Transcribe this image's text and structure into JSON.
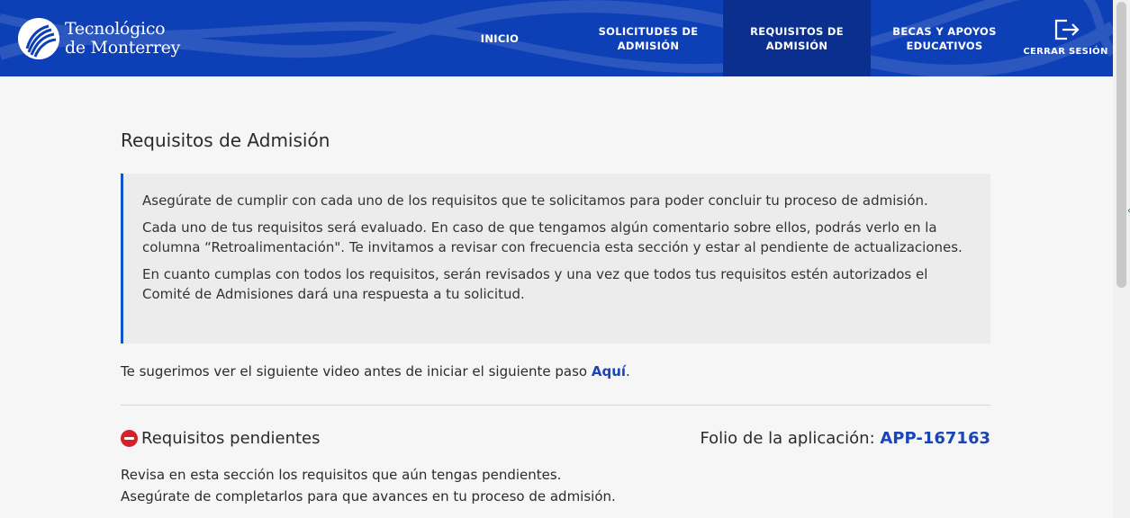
{
  "header": {
    "logo_line1": "Tecnológico",
    "logo_line2": "de Monterrey",
    "nav": {
      "inicio": "INICIO",
      "solicitudes_line1": "SOLICITUDES DE",
      "solicitudes_line2": "ADMISIÓN",
      "requisitos_line1": "REQUISITOS DE",
      "requisitos_line2": "ADMISIÓN",
      "becas_line1": "BECAS Y APOYOS",
      "becas_line2": "EDUCATIVOS",
      "logout": "CERRAR SESIÓN"
    },
    "active_tab": "requisitos",
    "colors": {
      "header_bg": "#0d3fb6",
      "active_tab_bg": "#0b2f8f"
    }
  },
  "main": {
    "title": "Requisitos de Admisión",
    "info": {
      "p1": "Asegúrate de cumplir con cada uno de los requisitos que te solicitamos para poder concluir tu proceso de admisión.",
      "p2": "Cada uno de tus requisitos será evaluado. En caso de que tengamos algún comentario sobre ellos, podrás verlo en la columna “Retroalimentación\". Te invitamos a revisar con frecuencia esta sección y estar al pendiente de actualizaciones.",
      "p3": "En cuanto cumplas con todos los requisitos, serán revisados y una vez que todos tus requisitos estén autorizados el Comité de Admisiones dará una respuesta a tu solicitud."
    },
    "video": {
      "text": "Te sugerimos ver el siguiente video antes de iniciar el siguiente paso ",
      "link": "Aquí",
      "suffix": "."
    },
    "pending": {
      "title": "Requisitos pendientes",
      "folio_label": "Folio de la aplicación: ",
      "folio_value": "APP-167163",
      "desc_line1": "Revisa en esta sección los requisitos que aún tengas pendientes.",
      "desc_line2": "Asegúrate de completarlos para que avances en tu proceso de admisión."
    },
    "colors": {
      "link": "#1a45b8",
      "accent_border": "#1255c9",
      "pending_icon": "#d6202a"
    }
  }
}
